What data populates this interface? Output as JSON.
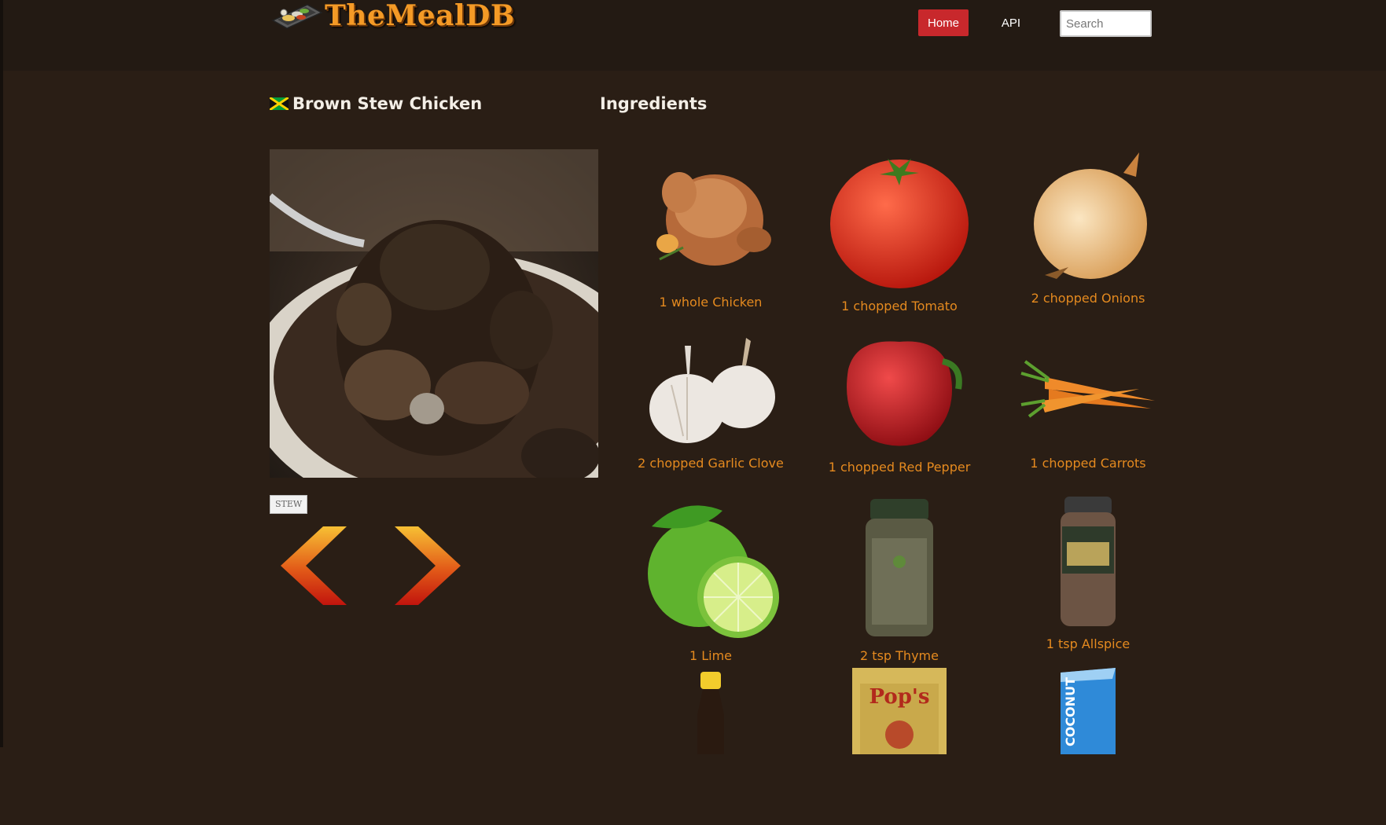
{
  "header": {
    "logo_text": "TheMealDB",
    "nav": {
      "home_label": "Home",
      "api_label": "API"
    },
    "search": {
      "placeholder": "Search",
      "value": ""
    }
  },
  "meal": {
    "name": "Brown Stew Chicken",
    "flag": "jamaica-flag-icon",
    "tag": "STEW"
  },
  "ingredients_heading": "Ingredients",
  "ingredients": [
    {
      "label": "1 whole Chicken",
      "icon": "chicken-icon"
    },
    {
      "label": "1 chopped Tomato",
      "icon": "tomato-icon"
    },
    {
      "label": "2 chopped Onions",
      "icon": "onion-icon"
    },
    {
      "label": "2 chopped Garlic Clove",
      "icon": "garlic-icon"
    },
    {
      "label": "1 chopped Red Pepper",
      "icon": "red-pepper-icon"
    },
    {
      "label": "1 chopped Carrots",
      "icon": "carrots-icon"
    },
    {
      "label": "1 Lime",
      "icon": "lime-icon"
    },
    {
      "label": "2 tsp Thyme",
      "icon": "thyme-jar-icon"
    },
    {
      "label": "1 tsp Allspice",
      "icon": "allspice-jar-icon"
    },
    {
      "label": "",
      "icon": "sauce-bottle-icon"
    },
    {
      "label": "",
      "icon": "pops-box-icon"
    },
    {
      "label": "",
      "icon": "coconut-milk-carton-icon"
    }
  ],
  "navigation": {
    "prev_icon": "chevron-left-icon",
    "next_icon": "chevron-right-icon"
  },
  "colors": {
    "background": "#2a1e15",
    "header": "#231a13",
    "accent_red": "#c8282c",
    "ingredient_text": "#e58a1f",
    "logo": "#f49a26"
  }
}
